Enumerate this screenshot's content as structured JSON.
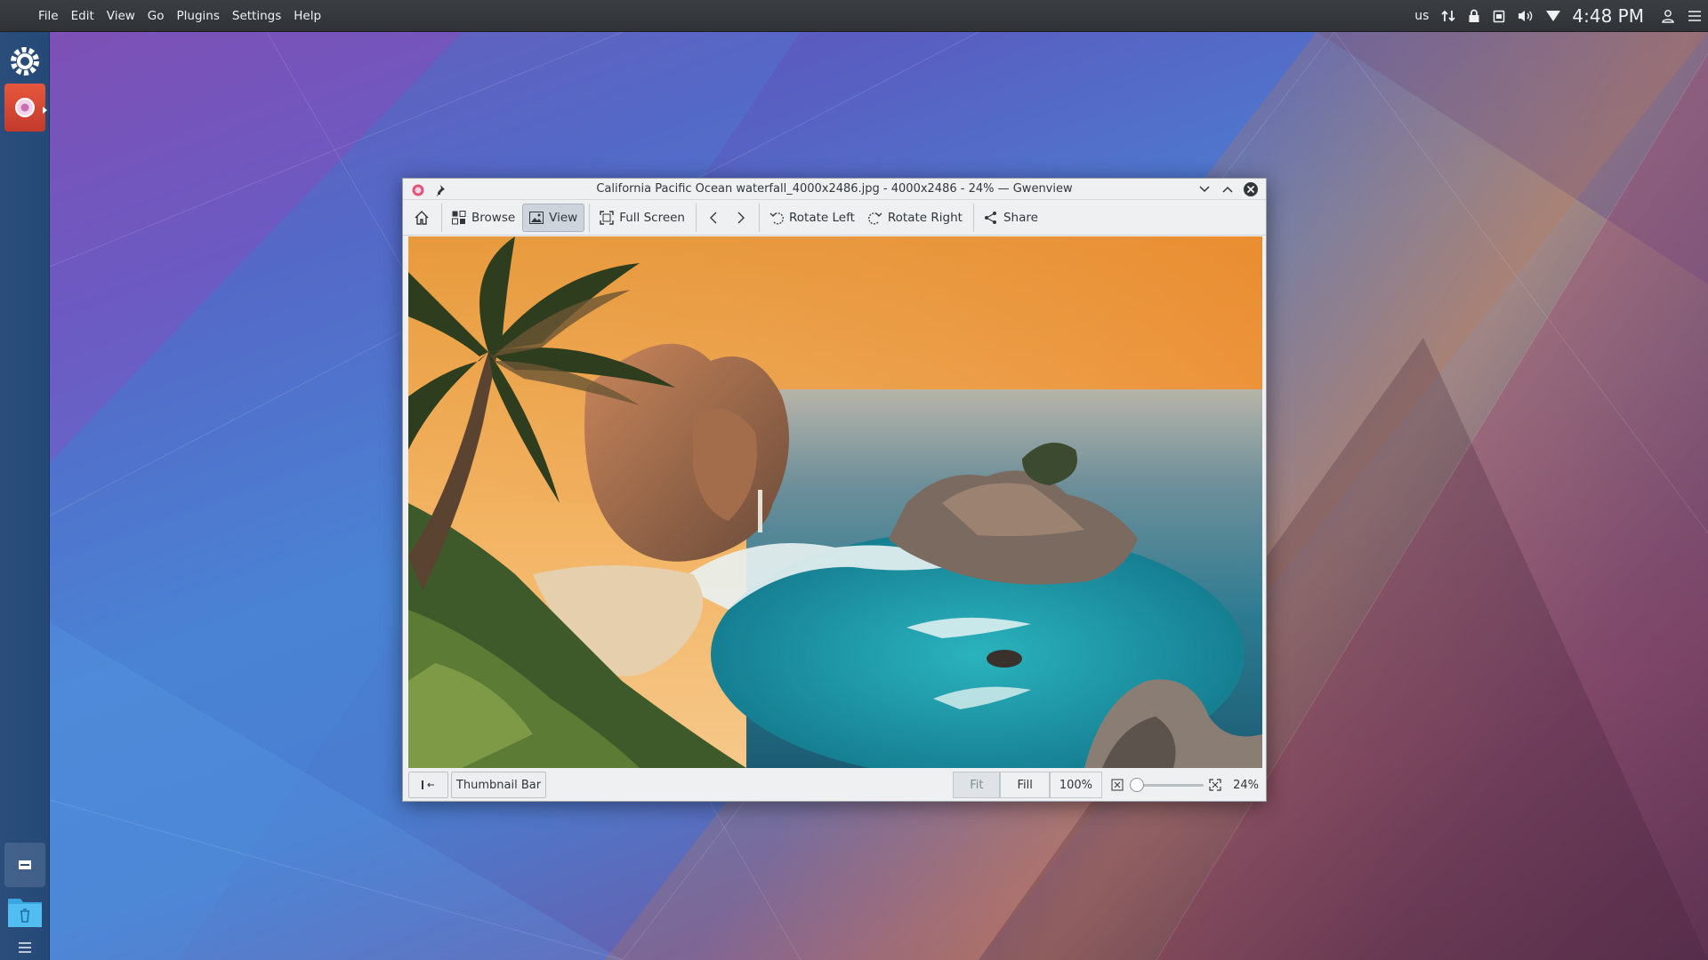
{
  "menubar": {
    "items": [
      "File",
      "Edit",
      "View",
      "Go",
      "Plugins",
      "Settings",
      "Help"
    ]
  },
  "tray": {
    "keyboard_layout": "us",
    "clock": "4:48 PM",
    "icons": [
      "network-icon",
      "lock-icon",
      "clipboard-icon",
      "volume-icon",
      "wifi-icon",
      "user-icon",
      "menu-icon"
    ]
  },
  "dock": {
    "items": [
      "settings-icon",
      "gwenview-app",
      "terminal-icon",
      "trash-folder-icon",
      "menu-icon"
    ]
  },
  "window": {
    "title": "California Pacific Ocean waterfall_4000x2486.jpg - 4000x2486 - 24% — Gwenview",
    "toolbar": {
      "browse": "Browse",
      "view": "View",
      "full_screen": "Full Screen",
      "rotate_left": "Rotate Left",
      "rotate_right": "Rotate Right",
      "share": "Share"
    },
    "statusbar": {
      "thumbnail_bar": "Thumbnail Bar",
      "fit": "Fit",
      "fill": "Fill",
      "hundred": "100%",
      "zoom_value": "24%",
      "zoom_fraction": 0.02
    }
  },
  "colors": {
    "accent": "#3daee9",
    "panel": "#31363b",
    "window_bg": "#eff0f1"
  }
}
